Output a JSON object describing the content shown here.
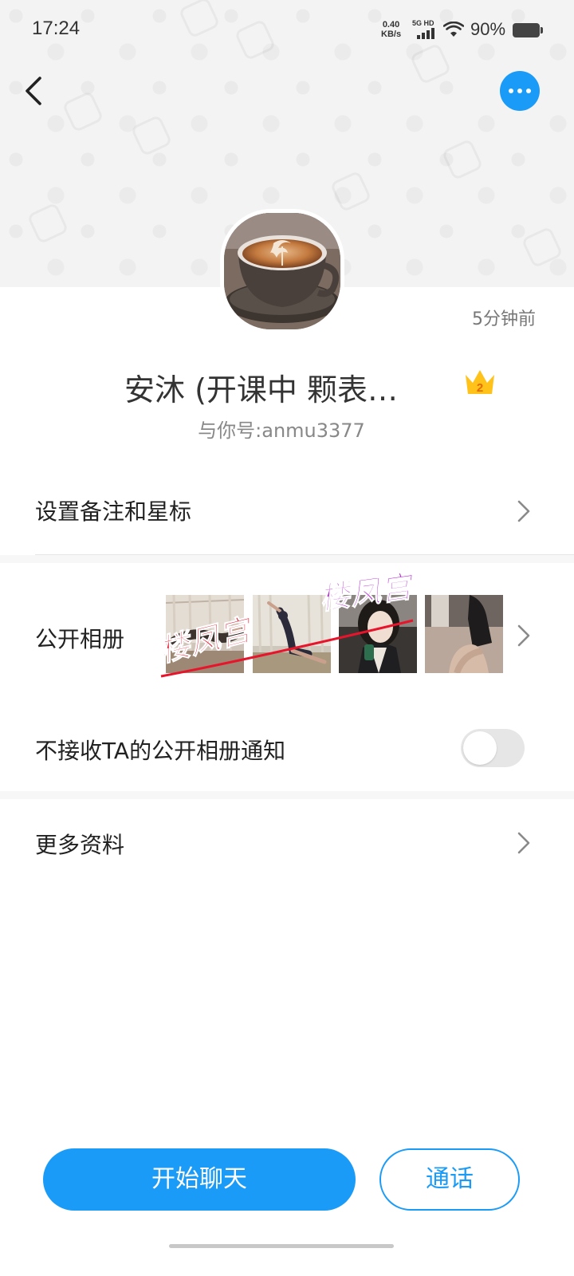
{
  "status_bar": {
    "time": "17:24",
    "net_speed_value": "0.40",
    "net_speed_unit": "KB/s",
    "signal_label": "5G HD",
    "battery": "90%"
  },
  "profile": {
    "last_seen": "5分钟前",
    "name": "安沐 (开课中  颗表…",
    "account_id": "与你号:anmu3377",
    "crown_level": "2"
  },
  "menu": {
    "remark_label": "设置备注和星标",
    "album_label": "公开相册",
    "album_notify_label": "不接收TA的公开相册通知",
    "album_notify_enabled": false,
    "more_info_label": "更多资料"
  },
  "album": {
    "watermark_1": "楼凤宫",
    "watermark_2": "楼凤宫"
  },
  "actions": {
    "chat_label": "开始聊天",
    "call_label": "通话"
  },
  "colors": {
    "accent": "#1a9bf7",
    "watermark_red": "#e8142b",
    "watermark_purple": "#b51fd6"
  }
}
